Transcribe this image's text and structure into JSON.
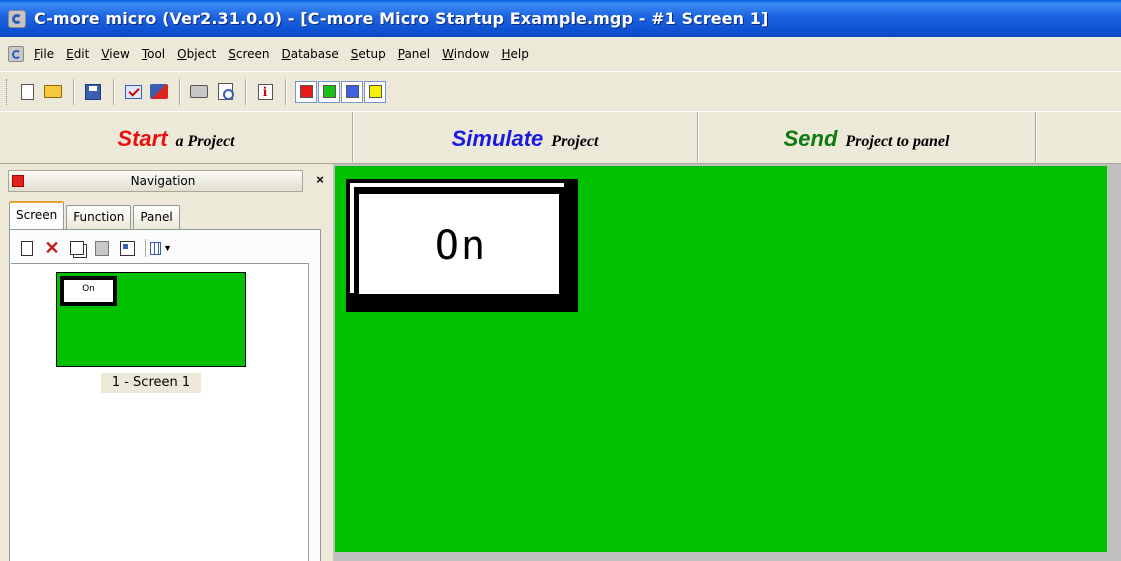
{
  "window": {
    "title": "C-more micro (Ver2.31.0.0) - [C-more Micro Startup Example.mgp - #1 Screen 1]"
  },
  "menu": {
    "items": [
      "File",
      "Edit",
      "View",
      "Tool",
      "Object",
      "Screen",
      "Database",
      "Setup",
      "Panel",
      "Window",
      "Help"
    ]
  },
  "toolbar": {
    "buttons": [
      "new-icon",
      "open-icon",
      "save-icon",
      "check-project-icon",
      "transfer-icon",
      "print-icon",
      "print-preview-icon",
      "info-icon"
    ],
    "colors": [
      "#e81b1b",
      "#19c01a",
      "#3e5fe0",
      "#f5f000"
    ]
  },
  "actions": {
    "start": {
      "big": "Start",
      "small": "a Project",
      "color": "#e81010"
    },
    "simulate": {
      "big": "Simulate",
      "small": "Project",
      "color": "#1a1ae0"
    },
    "send": {
      "big": "Send",
      "small": "Project to panel",
      "color": "#0f7a0f"
    }
  },
  "navigation": {
    "title": "Navigation",
    "close": "×",
    "tabs": [
      "Screen",
      "Function",
      "Panel"
    ],
    "active_tab": "Screen",
    "screens": [
      {
        "label": "1 - Screen 1",
        "thumb_button_text": "On"
      }
    ]
  },
  "screen": {
    "background": "#00c000",
    "pushbutton_text": "On"
  }
}
